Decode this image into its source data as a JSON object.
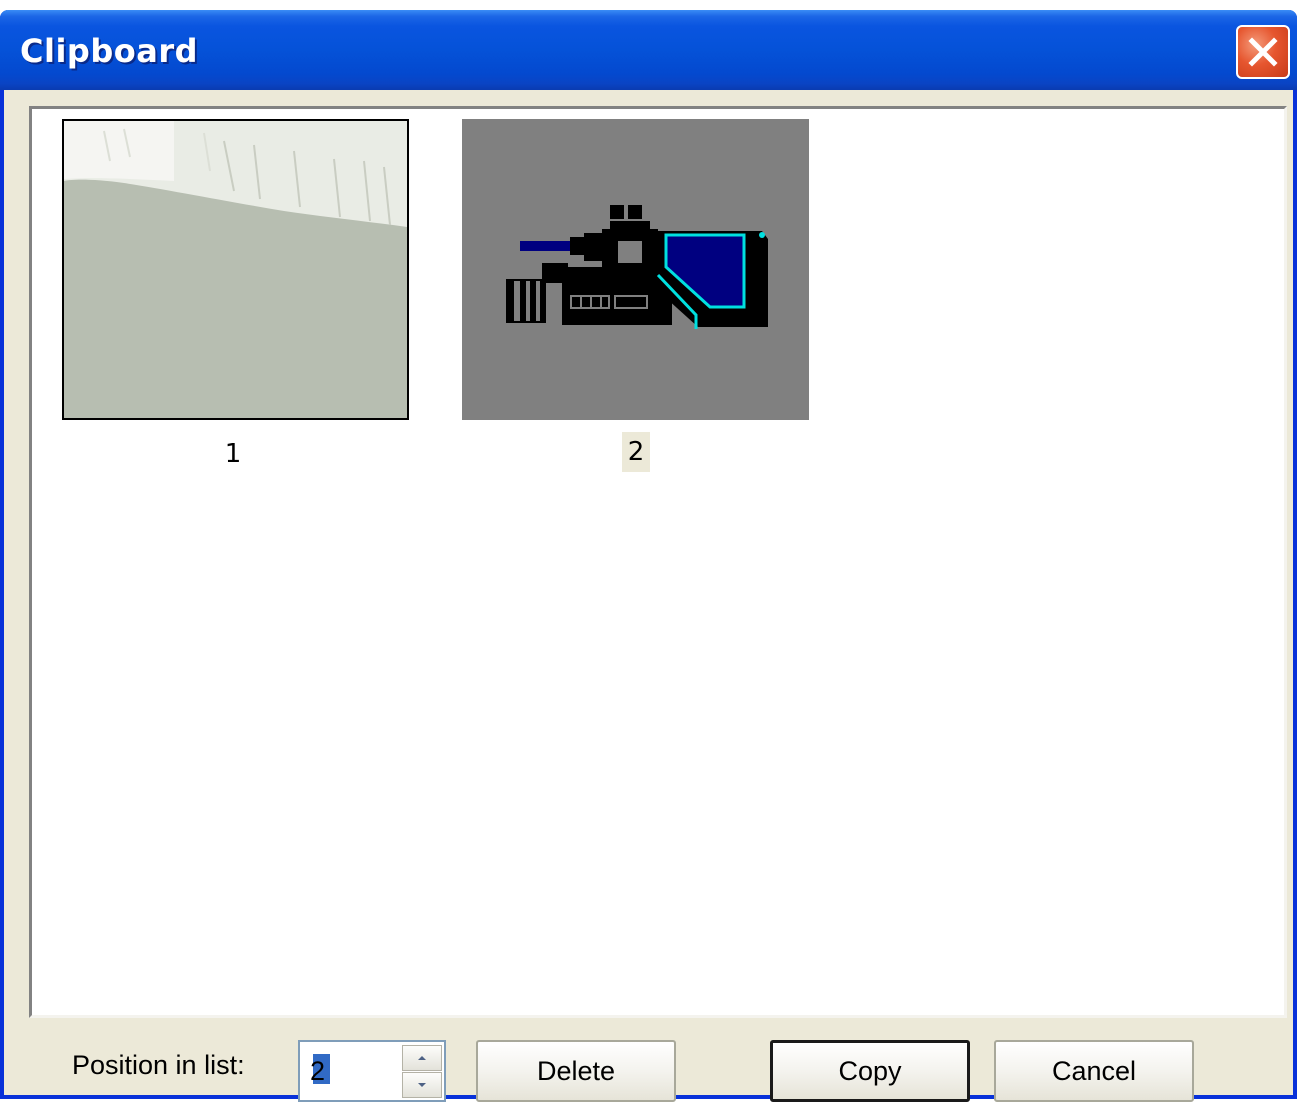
{
  "window": {
    "title": "Clipboard"
  },
  "clipboard_items": [
    {
      "label": "1",
      "description": "grey-green image with white streak",
      "selected": false
    },
    {
      "label": "2",
      "description": "video camera clip art",
      "selected": true
    }
  ],
  "footer": {
    "position_label": "Position in list:",
    "position_value": "2",
    "delete_label": "Delete",
    "copy_label": "Copy",
    "cancel_label": "Cancel"
  },
  "icons": {
    "close": "close-icon",
    "spin_up": "spin-up-icon",
    "spin_down": "spin-down-icon"
  },
  "colors": {
    "titlebar": "#0552d8",
    "close_button": "#e6562f",
    "dialog_face": "#ece9d8",
    "selection": "#316ac5"
  }
}
